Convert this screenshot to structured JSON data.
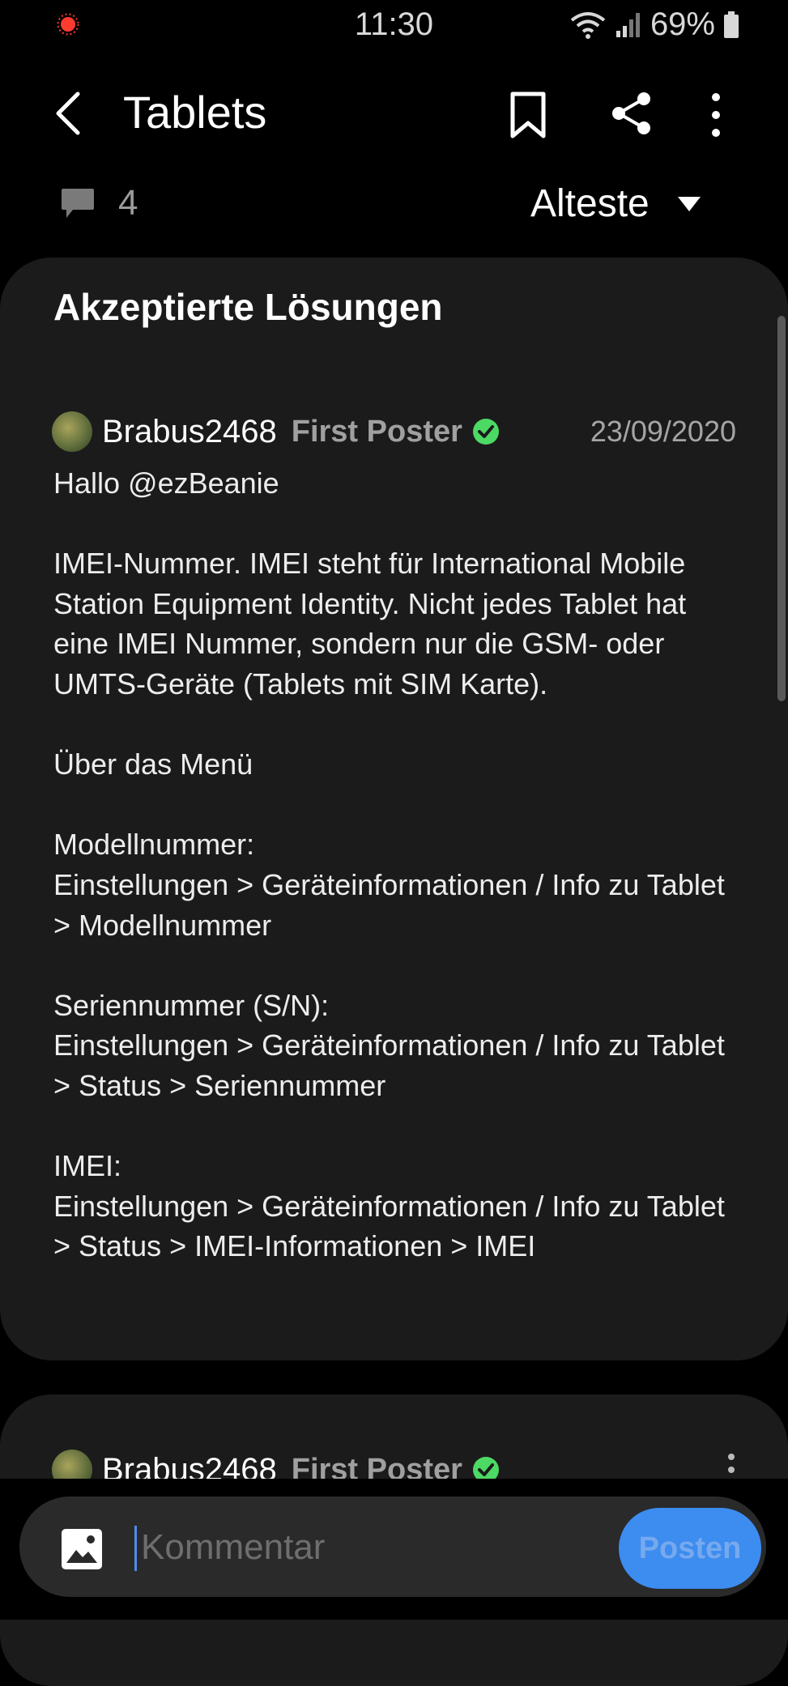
{
  "status_bar": {
    "time": "11:30",
    "battery": "69%"
  },
  "app_bar": {
    "title": "Tablets"
  },
  "sub_bar": {
    "comment_count": "4",
    "sort_label": "Alteste"
  },
  "accepted_card": {
    "title": "Akzeptierte Lösungen",
    "post": {
      "username": "Brabus2468",
      "rank": "First Poster",
      "date": "23/09/2020",
      "body": "Hallo @ezBeanie\n\nIMEI-Nummer. IMEI steht für International Mobile Station Equipment Identity. Nicht jedes Tablet hat eine IMEI Nummer, sondern nur die GSM- oder UMTS-Geräte (Tablets mit SIM Karte).\n\nÜber das Menü\n\nModellnummer:\nEinstellungen > Geräteinformationen / Info zu Tablet > Modellnummer\n\nSeriennummer (S/N):\nEinstellungen > Geräteinformationen / Info zu Tablet > Status > Seriennummer\n\nIMEI:\nEinstellungen > Geräteinformationen / Info zu Tablet > Status > IMEI-Informationen > IMEI"
    }
  },
  "second_card": {
    "username": "Brabus2468",
    "rank": "First Poster"
  },
  "comment_bar": {
    "placeholder": "Kommentar",
    "post_label": "Posten"
  },
  "colors": {
    "background": "#000000",
    "card": "#1b1b1b",
    "accent": "#3d8cf0",
    "verified": "#4cd964"
  },
  "icons": [
    "record-icon",
    "wifi-icon",
    "signal-icon",
    "battery-icon",
    "back-icon",
    "bookmark-icon",
    "share-icon",
    "more-vert-icon",
    "comment-icon",
    "dropdown-icon",
    "verified-icon",
    "image-icon"
  ]
}
